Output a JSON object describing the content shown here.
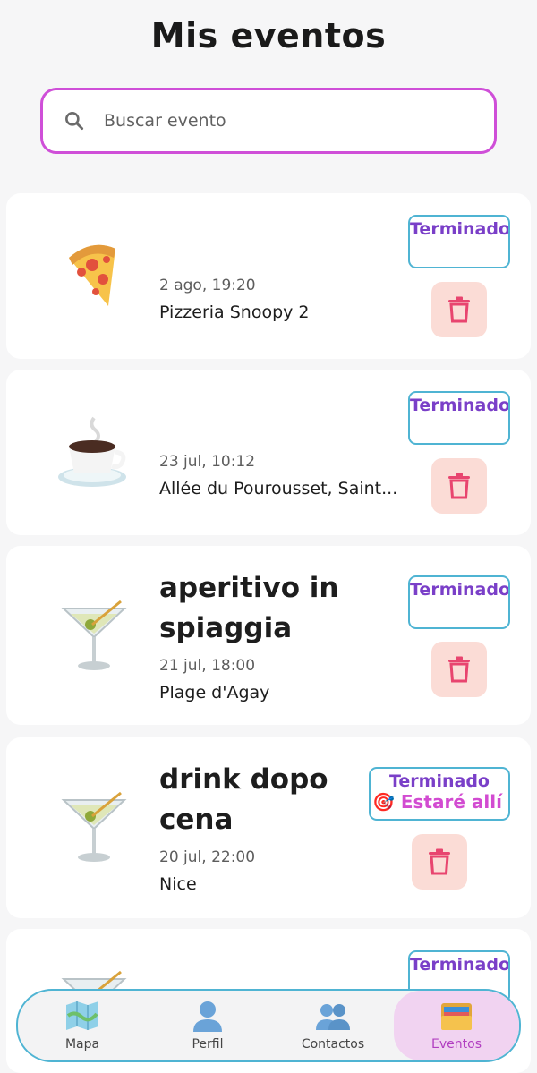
{
  "header": {
    "title": "Mis eventos"
  },
  "search": {
    "placeholder": "Buscar evento",
    "value": ""
  },
  "events": [
    {
      "emoji": "pizza-icon",
      "title": "",
      "date": "2 ago, 19:20",
      "place": "Pizzeria Snoopy 2",
      "status": "Terminado",
      "extra": ""
    },
    {
      "emoji": "coffee-icon",
      "title": "",
      "date": "23 jul, 10:12",
      "place": "Allée du Pourousset, Saint...",
      "status": "Terminado",
      "extra": ""
    },
    {
      "emoji": "cocktail-icon",
      "title": "aperitivo in spiaggia",
      "date": "21 jul, 18:00",
      "place": "Plage d'Agay",
      "status": "Terminado",
      "extra": ""
    },
    {
      "emoji": "cocktail-icon",
      "title": "drink dopo cena",
      "date": "20 jul, 22:00",
      "place": "Nice",
      "status": "Terminado",
      "extra": "🎯 Estaré allí"
    },
    {
      "emoji": "cocktail-icon",
      "title": "",
      "date": "",
      "place": "",
      "status": "Terminado",
      "extra": ""
    }
  ],
  "nav": {
    "items": [
      {
        "label": "Mapa",
        "icon": "map-icon"
      },
      {
        "label": "Perfil",
        "icon": "person-icon"
      },
      {
        "label": "Contactos",
        "icon": "people-icon"
      },
      {
        "label": "Eventos",
        "icon": "folder-icon"
      }
    ],
    "active": "Eventos"
  },
  "colors": {
    "accent": "#cf4fd8",
    "status_border": "#4fb4d3",
    "status_text": "#7a3fc8",
    "trash_bg": "#fbdcd6",
    "trash_icon": "#e8456f",
    "active_nav_bg": "#f1d3f1"
  }
}
